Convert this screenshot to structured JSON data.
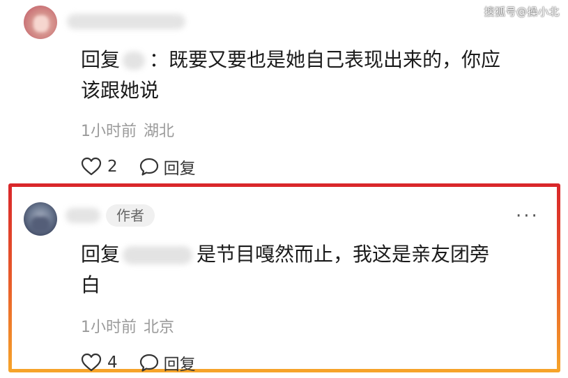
{
  "watermark": "搜狐号@操小北",
  "comments": [
    {
      "reply_prefix": "回复",
      "text_line1": "：既要又要也是她自己表现出来的，你应",
      "text_line2": "该跟她说",
      "time": "1小时前",
      "location": "湖北",
      "likes": "2",
      "reply_label": "回复"
    },
    {
      "author_badge": "作者",
      "more": "···",
      "reply_prefix": "回复",
      "text_line1": "是节目嘎然而止，我这是亲友团旁",
      "text_line2": "白",
      "time": "1小时前",
      "location": "北京",
      "likes": "4",
      "reply_label": "回复"
    }
  ],
  "colors": {
    "highlight_top": "#d9262a",
    "highlight_bottom": "#f6a52a"
  }
}
